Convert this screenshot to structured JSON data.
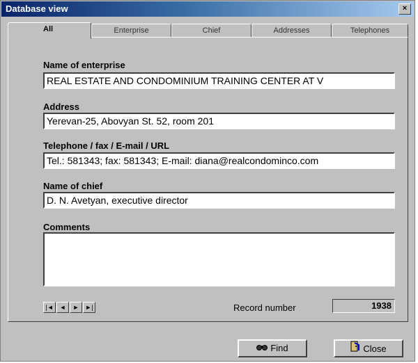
{
  "window": {
    "title": "Database view",
    "close_label": "×"
  },
  "tabs": [
    {
      "label": "All"
    },
    {
      "label": "Enterprise"
    },
    {
      "label": "Chief"
    },
    {
      "label": "Addresses"
    },
    {
      "label": "Telephones"
    }
  ],
  "fields": {
    "enterprise": {
      "label": "Name of enterprise",
      "value": "REAL ESTATE AND CONDOMINIUM TRAINING CENTER AT V"
    },
    "address": {
      "label": "Address",
      "value": "Yerevan-25, Abovyan St. 52, room 201"
    },
    "telephone": {
      "label": "Telephone / fax / E-mail / URL",
      "value": "Tel.: 581343; fax: 581343; E-mail: diana@realcondominco.com"
    },
    "chief": {
      "label": "Name of chief",
      "value": "D. N. Avetyan, executive director"
    },
    "comments": {
      "label": "Comments",
      "value": ""
    }
  },
  "navigator": {
    "first": "|◄",
    "prev": "◄",
    "next": "►",
    "last": "►|"
  },
  "record": {
    "label": "Record number",
    "value": "1938"
  },
  "buttons": {
    "find": "Find",
    "close": "Close"
  },
  "icons": {
    "find": "binoculars-icon",
    "close": "exit-door-icon"
  }
}
